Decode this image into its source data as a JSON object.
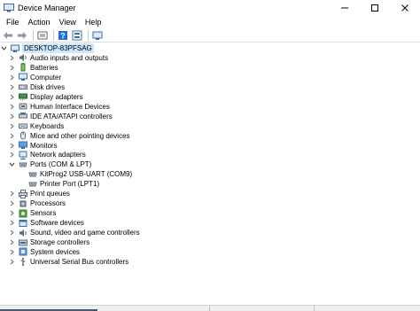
{
  "window": {
    "title": "Device Manager"
  },
  "menu": [
    {
      "label": "File"
    },
    {
      "label": "Action"
    },
    {
      "label": "View"
    },
    {
      "label": "Help"
    }
  ],
  "toolbar": [
    "back",
    "forward",
    "properties-sheet",
    "help",
    "device-list",
    "monitor"
  ],
  "tree": {
    "root": "DESKTOP-83PFSAG",
    "items": [
      {
        "label": "Audio inputs and outputs",
        "icon": "speaker-icon",
        "expanded": false
      },
      {
        "label": "Batteries",
        "icon": "battery-icon",
        "expanded": false
      },
      {
        "label": "Computer",
        "icon": "computer-icon",
        "expanded": false
      },
      {
        "label": "Disk drives",
        "icon": "disk-drive-icon",
        "expanded": false
      },
      {
        "label": "Display adapters",
        "icon": "display-adapter-icon",
        "expanded": false
      },
      {
        "label": "Human Interface Devices",
        "icon": "hid-icon",
        "expanded": false
      },
      {
        "label": "IDE ATA/ATAPI controllers",
        "icon": "ide-controller-icon",
        "expanded": false
      },
      {
        "label": "Keyboards",
        "icon": "keyboard-icon",
        "expanded": false
      },
      {
        "label": "Mice and other pointing devices",
        "icon": "mouse-icon",
        "expanded": false
      },
      {
        "label": "Monitors",
        "icon": "monitor-icon",
        "expanded": false
      },
      {
        "label": "Network adapters",
        "icon": "network-adapter-icon",
        "expanded": false
      },
      {
        "label": "Ports (COM & LPT)",
        "icon": "port-icon",
        "expanded": true,
        "children": [
          {
            "label": "KitProg2 USB-UART (COM9)",
            "icon": "port-icon"
          },
          {
            "label": "Printer Port (LPT1)",
            "icon": "port-icon"
          }
        ]
      },
      {
        "label": "Print queues",
        "icon": "print-queue-icon",
        "expanded": false
      },
      {
        "label": "Processors",
        "icon": "processor-icon",
        "expanded": false
      },
      {
        "label": "Sensors",
        "icon": "sensor-icon",
        "expanded": false
      },
      {
        "label": "Software devices",
        "icon": "software-device-icon",
        "expanded": false
      },
      {
        "label": "Sound, video and game controllers",
        "icon": "speaker-icon",
        "expanded": false
      },
      {
        "label": "Storage controllers",
        "icon": "storage-controller-icon",
        "expanded": false
      },
      {
        "label": "System devices",
        "icon": "system-device-icon",
        "expanded": false
      },
      {
        "label": "Universal Serial Bus controllers",
        "icon": "usb-icon",
        "expanded": false
      }
    ]
  },
  "colors": {
    "selection": "#cce8ff",
    "accent_blue": "#1e6fd9",
    "icon_gray": "#5a6b7b"
  }
}
